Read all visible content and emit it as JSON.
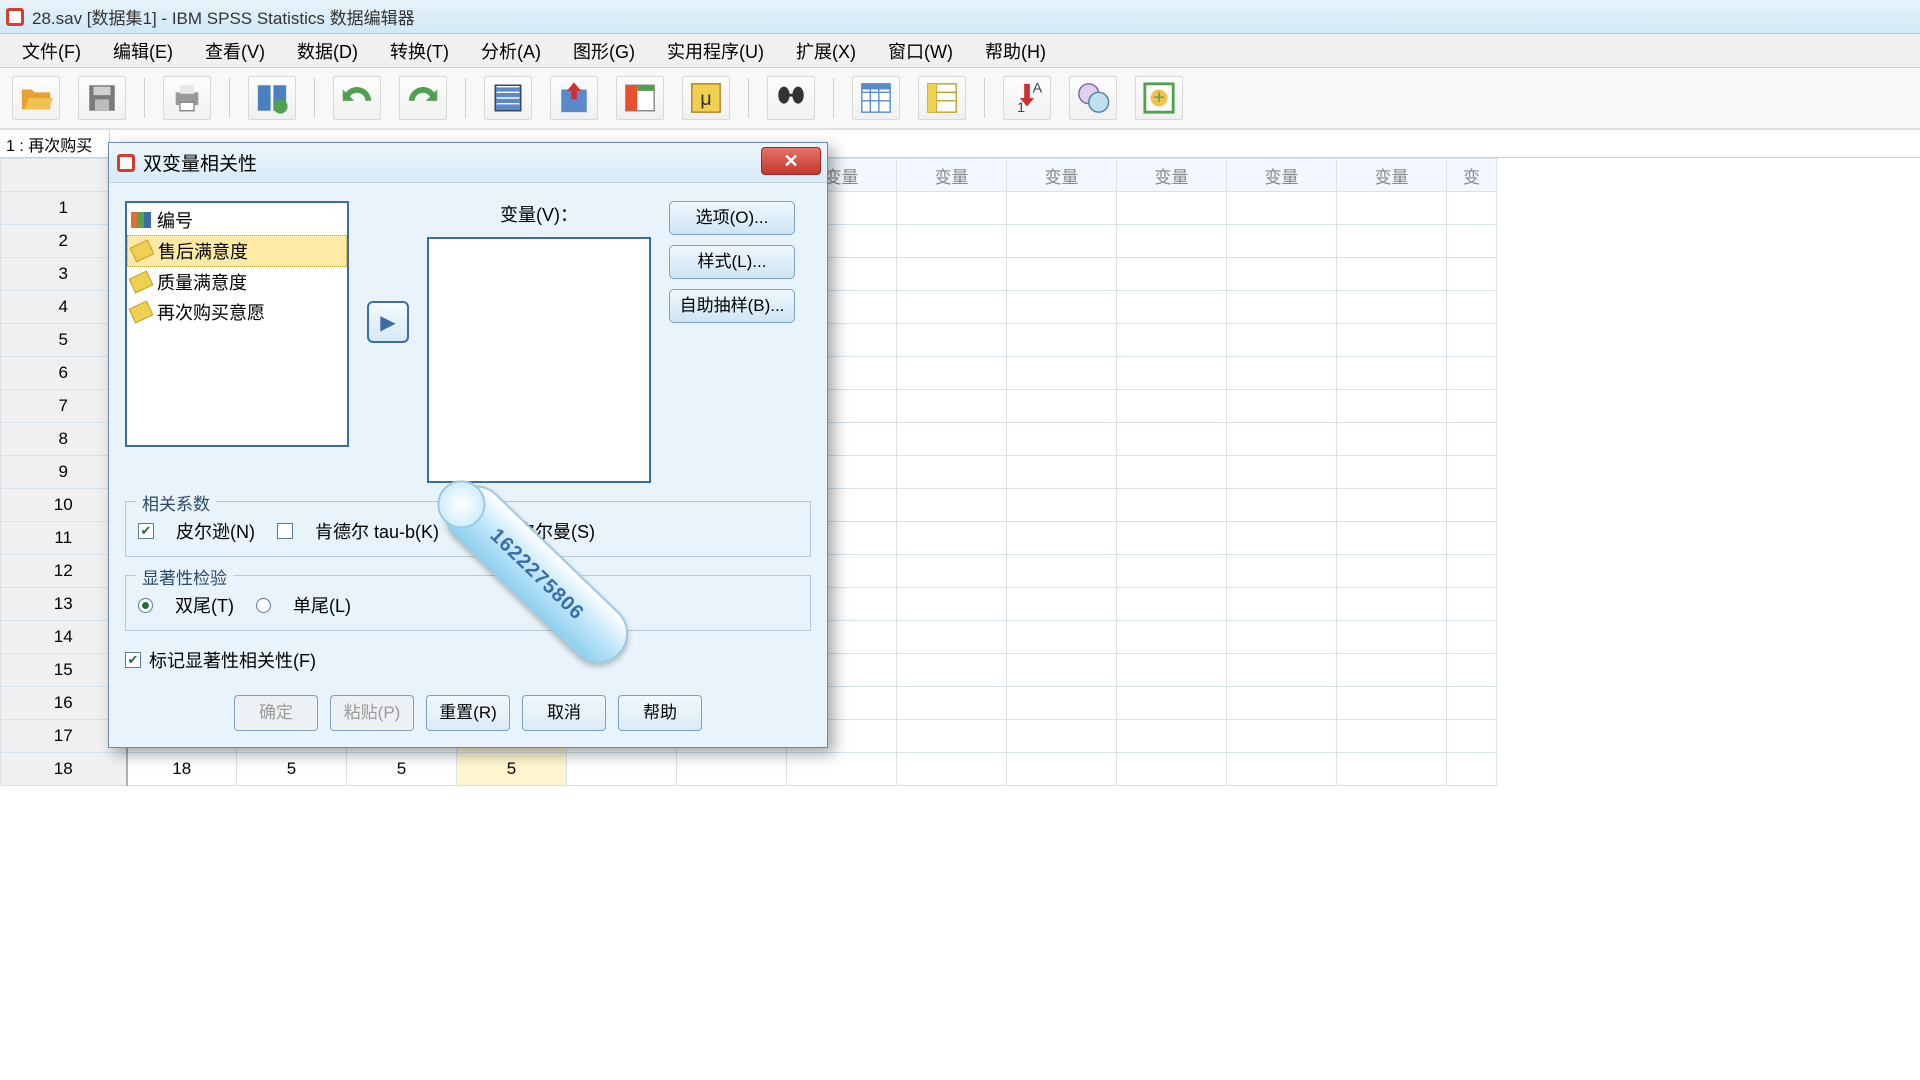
{
  "window": {
    "title": "28.sav [数据集1] - IBM SPSS Statistics 数据编辑器"
  },
  "menu": {
    "file": "文件(F)",
    "edit": "编辑(E)",
    "view": "查看(V)",
    "data": "数据(D)",
    "transform": "转换(T)",
    "analyze": "分析(A)",
    "graphs": "图形(G)",
    "utilities": "实用程序(U)",
    "extensions": "扩展(X)",
    "window": "窗口(W)",
    "help": "帮助(H)"
  },
  "cell_indicator": {
    "label": "1 : 再次购买"
  },
  "sheet": {
    "placeholder_col": "变量",
    "extra_col": "变",
    "rows": [
      1,
      2,
      3,
      4,
      5,
      6,
      7,
      8,
      9,
      10,
      11,
      12,
      13,
      14,
      15,
      16,
      17,
      18
    ],
    "visible_data_row": {
      "num": 18,
      "c1": "18",
      "c2": "5",
      "c3": "5",
      "c4": "5"
    }
  },
  "dialog": {
    "title": "双变量相关性",
    "variables_label": "变量(V)：",
    "source_items": [
      {
        "label": "编号",
        "icon": "bar"
      },
      {
        "label": "售后满意度",
        "icon": "ruler",
        "selected": true
      },
      {
        "label": "质量满意度",
        "icon": "ruler"
      },
      {
        "label": "再次购买意愿",
        "icon": "ruler"
      }
    ],
    "right_buttons": {
      "options": "选项(O)...",
      "style": "样式(L)...",
      "bootstrap": "自助抽样(B)..."
    },
    "coef_group": {
      "legend": "相关系数",
      "pearson": {
        "label": "皮尔逊(N)",
        "checked": true
      },
      "kendall": {
        "label": "肯德尔 tau-b(K)",
        "checked": false
      },
      "spearman": {
        "label": "斯皮尔曼(S)",
        "checked": false
      }
    },
    "sig_group": {
      "legend": "显著性检验",
      "two_tailed": {
        "label": "双尾(T)",
        "selected": true
      },
      "one_tailed": {
        "label": "单尾(L)",
        "selected": false
      }
    },
    "flag": {
      "label": "标记显著性相关性(F)",
      "checked": true
    },
    "actions": {
      "ok": "确定",
      "paste": "粘贴(P)",
      "reset": "重置(R)",
      "cancel": "取消",
      "help": "帮助"
    }
  },
  "watermark": "1622275806"
}
